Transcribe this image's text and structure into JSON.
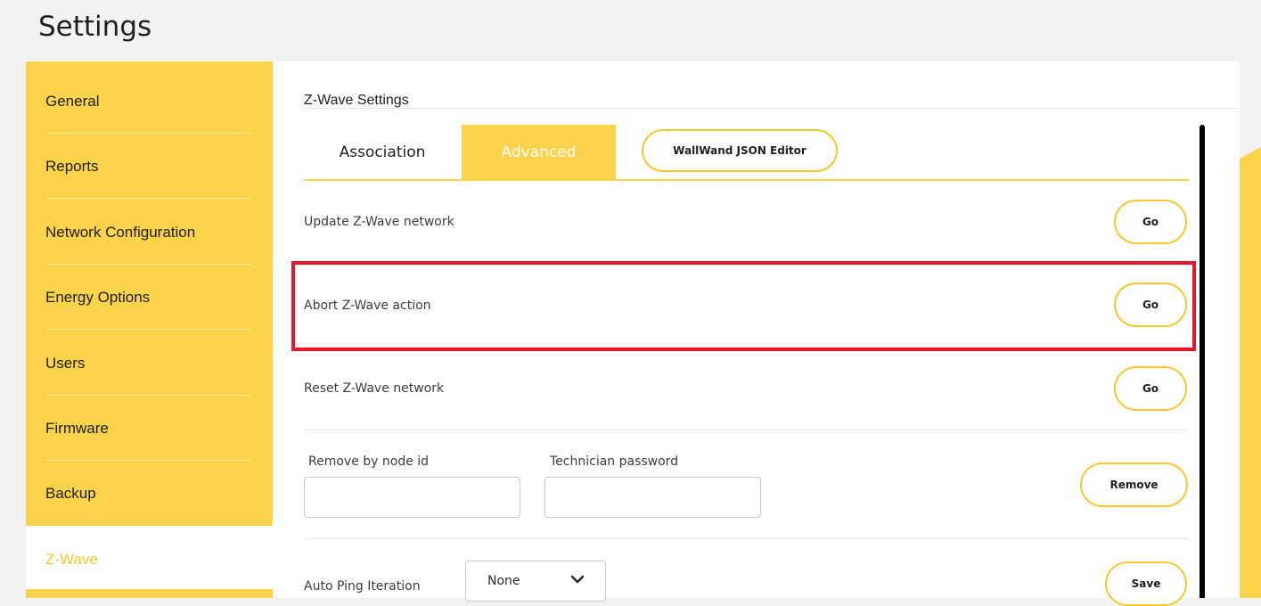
{
  "page": {
    "title": "Settings"
  },
  "sidebar": {
    "items": [
      {
        "label": "General"
      },
      {
        "label": "Reports"
      },
      {
        "label": "Network Configuration"
      },
      {
        "label": "Energy Options"
      },
      {
        "label": "Users"
      },
      {
        "label": "Firmware"
      },
      {
        "label": "Backup"
      },
      {
        "label": "Z-Wave",
        "active": true
      }
    ]
  },
  "zwave": {
    "section_title": "Z-Wave Settings",
    "tabs": [
      {
        "label": "Association"
      },
      {
        "label": "Advanced",
        "active": true
      },
      {
        "label": "WallWand JSON Editor"
      }
    ],
    "rows": [
      {
        "label": "Update Z-Wave network",
        "button": "Go"
      },
      {
        "label": "Abort Z-Wave action",
        "button": "Go",
        "highlighted": true
      },
      {
        "label": "Reset Z-Wave network",
        "button": "Go"
      }
    ],
    "remove_node": {
      "node_id_label": "Remove by node id",
      "node_id_value": "",
      "password_label": "Technician password",
      "password_value": "",
      "button": "Remove"
    },
    "auto_ping": {
      "label": "Auto Ping Iteration",
      "selected": "None",
      "button": "Save"
    }
  },
  "colors": {
    "accent": "#fad34a",
    "accent_border": "#f6c72e",
    "highlight": "#e3182d",
    "background": "#f2f2f2"
  },
  "icons": {
    "dropdown": "chevron-down-icon"
  }
}
